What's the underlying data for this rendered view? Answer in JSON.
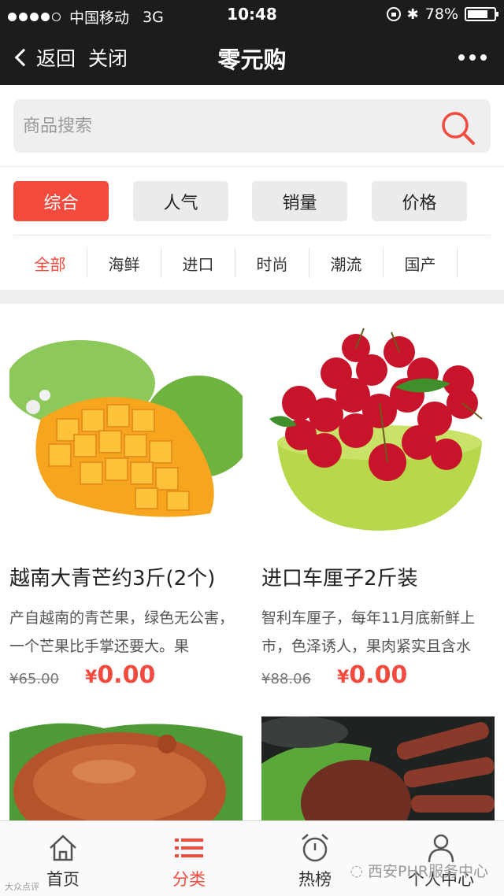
{
  "status_bar": {
    "carrier": "中国移动",
    "network": "3G",
    "time": "10:48",
    "battery": "78%",
    "battery_level": 0.78,
    "signal_bars_filled": 4,
    "signal_bars_total": 5
  },
  "nav": {
    "back_label": "返回",
    "close_label": "关闭",
    "title": "零元购",
    "more_icon": "more-dots-icon"
  },
  "search": {
    "placeholder": "商品搜索",
    "icon": "search-icon",
    "accent": "#f24a3d"
  },
  "sort_tabs": [
    {
      "label": "综合",
      "active": true
    },
    {
      "label": "人气",
      "active": false
    },
    {
      "label": "销量",
      "active": false
    },
    {
      "label": "价格",
      "active": false
    }
  ],
  "categories": [
    {
      "label": "全部",
      "active": true
    },
    {
      "label": "海鲜",
      "active": false
    },
    {
      "label": "进口",
      "active": false
    },
    {
      "label": "时尚",
      "active": false
    },
    {
      "label": "潮流",
      "active": false
    },
    {
      "label": "国产",
      "active": false
    }
  ],
  "products": [
    {
      "title": "越南大青芒约3斤(2个)",
      "desc": "产自越南的青芒果，绿色无公害，一个芒果比手掌还要大。果",
      "old_price": "¥65.00",
      "currency": "¥",
      "price": "0.00",
      "image": "mango-image"
    },
    {
      "title": "进口车厘子2斤装",
      "desc": "智利车厘子，每年11月底新鲜上市，色泽诱人，果肉紧实且含水",
      "old_price": "¥88.06",
      "currency": "¥",
      "price": "0.00",
      "image": "cherry-image"
    },
    {
      "image": "crab-image"
    },
    {
      "image": "king-crab-image"
    }
  ],
  "tab_bar": [
    {
      "label": "首页",
      "icon": "home-icon",
      "active": false
    },
    {
      "label": "分类",
      "icon": "list-icon",
      "active": true
    },
    {
      "label": "热榜",
      "icon": "alarm-clock-icon",
      "active": false
    },
    {
      "label": "个人中心",
      "icon": "person-icon",
      "active": false
    }
  ],
  "watermark": "西安PHR服务中心",
  "watermark_small": "大众点评"
}
